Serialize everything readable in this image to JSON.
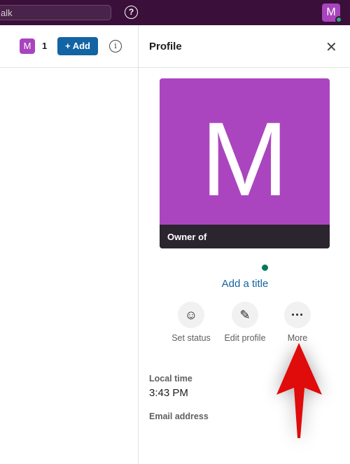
{
  "topbar": {
    "search_text": "alk",
    "help_icon": "question-circle-icon",
    "user_initial": "M"
  },
  "header": {
    "member_initial": "M",
    "member_count": "1",
    "add_label": "+ Add",
    "info_icon": "info-icon"
  },
  "profile": {
    "title": "Profile",
    "close_icon": "close-icon",
    "photo_letter": "M",
    "photo_caption": "Owner of",
    "add_title": "Add a title",
    "actions": [
      {
        "label": "Set status",
        "icon": "smiley-icon"
      },
      {
        "label": "Edit profile",
        "icon": "pencil-icon"
      },
      {
        "label": "More",
        "icon": "more-icon"
      }
    ],
    "local_time_label": "Local time",
    "local_time": "3:43 PM",
    "email_label": "Email address"
  },
  "colors": {
    "topbar": "#3a0f3a",
    "avatar": "#ab45bf",
    "accent": "#1264a3",
    "online": "#007a5a",
    "arrow": "#e00b0b"
  }
}
